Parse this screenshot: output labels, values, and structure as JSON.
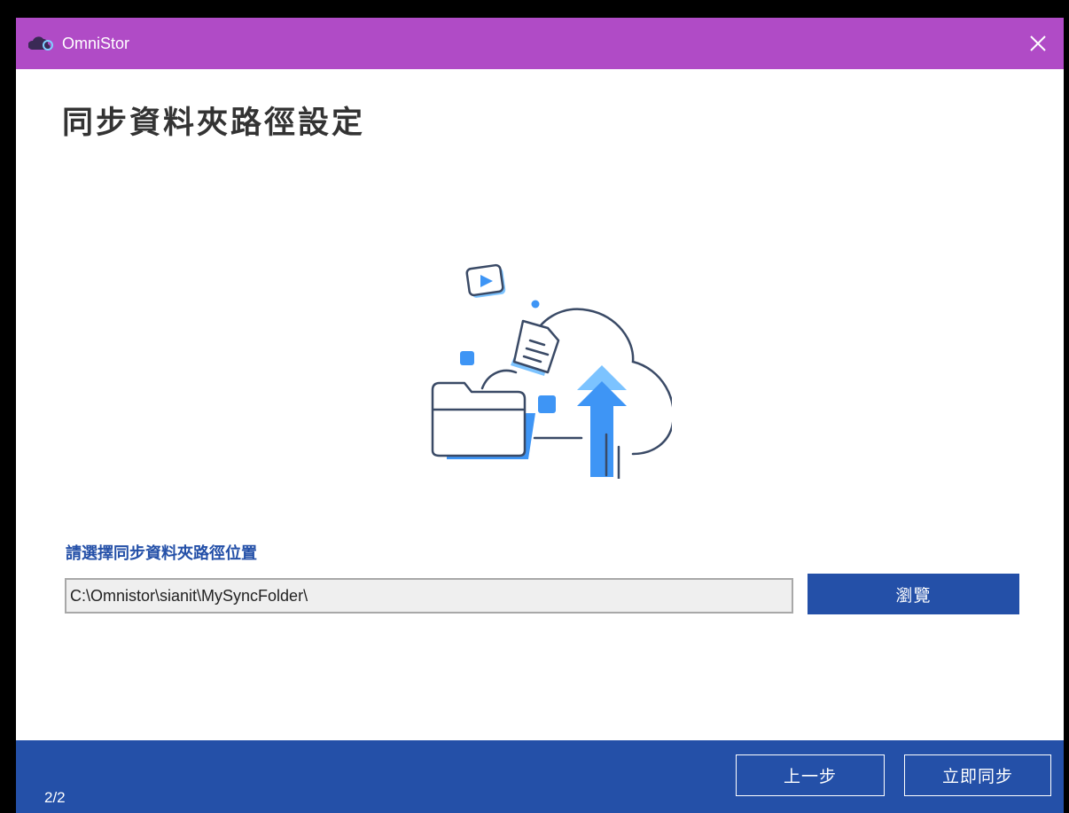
{
  "window": {
    "title": "OmniStor",
    "close_icon": "close-icon",
    "logo_icon": "cloud-logo-icon"
  },
  "main": {
    "heading": "同步資料夾路徑設定",
    "illustration_icon": "cloud-upload-illustration",
    "path_label": "請選擇同步資料夾路徑位置",
    "path_value": "C:\\Omnistor\\sianit\\MySyncFolder\\",
    "browse_label": "瀏覽"
  },
  "footer": {
    "step": "2/2",
    "back_label": "上一步",
    "sync_label": "立即同步"
  },
  "colors": {
    "titlebar": "#b04bc6",
    "primary": "#2450a8",
    "illustration_blue": "#3e95f5",
    "illustration_line": "#3a4a66"
  }
}
